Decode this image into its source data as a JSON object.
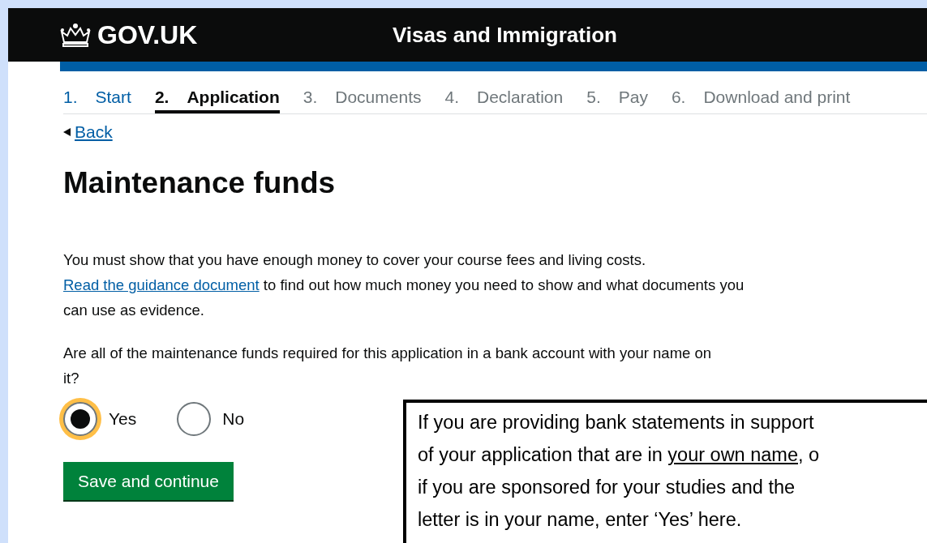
{
  "header": {
    "logo": "GOV.UK",
    "service": "Visas and Immigration"
  },
  "steps": [
    {
      "number": "1.",
      "label": "Start",
      "selected": false,
      "disabled": false
    },
    {
      "number": "2.",
      "label": "Application",
      "selected": true,
      "disabled": false
    },
    {
      "number": "3.",
      "label": "Documents",
      "selected": false,
      "disabled": true
    },
    {
      "number": "4.",
      "label": "Declaration",
      "selected": false,
      "disabled": true
    },
    {
      "number": "5.",
      "label": "Pay",
      "selected": false,
      "disabled": true
    },
    {
      "number": "6.",
      "label": "Download and print",
      "selected": false,
      "disabled": true
    }
  ],
  "back_link": "Back",
  "heading": "Maintenance funds",
  "intro": {
    "before": "You must show that you have enough money to cover your course fees and living costs.",
    "link": "Read the guidance document",
    "after": "to find out how much money you need to show and what documents you can use as evidence."
  },
  "question": "Are all of the maintenance funds required for this application in a bank account with your name on it?",
  "options": [
    {
      "label": "Yes",
      "selected": true
    },
    {
      "label": "No",
      "selected": false
    }
  ],
  "button": "Save and continue",
  "callout": {
    "lines": [
      [
        {
          "text": "If you are providing bank statements in support",
          "underline": false
        }
      ],
      [
        {
          "text": "of your application that are in ",
          "underline": false
        },
        {
          "text": "your own name",
          "underline": true
        },
        {
          "text": ", o",
          "underline": false
        }
      ],
      [
        {
          "text": "if you are sponsored for your studies and the",
          "underline": false
        }
      ],
      [
        {
          "text": "letter is in your name, enter ‘Yes’ here.",
          "underline": false
        }
      ]
    ]
  }
}
